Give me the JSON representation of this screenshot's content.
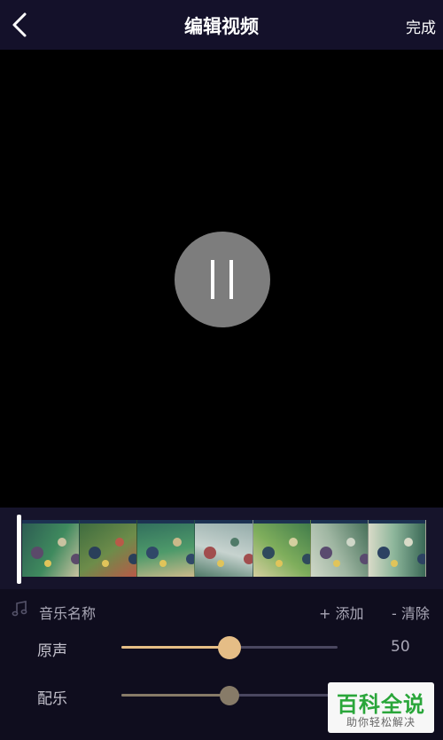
{
  "header": {
    "title": "编辑视频",
    "done_label": "完成",
    "back_icon": "chevron-left-icon"
  },
  "player": {
    "state": "playing",
    "control_icon": "pause-icon"
  },
  "timeline": {
    "frame_count": 7,
    "playhead_icon": "playhead-icon"
  },
  "music": {
    "icon": "music-note-icon",
    "name_label": "音乐名称",
    "add_label": "+ 添加",
    "clear_label": "- 清除"
  },
  "original_audio": {
    "label": "原声",
    "value": 50,
    "value_text": "50",
    "fill_color": "#e5bd86"
  },
  "music_audio": {
    "label": "配乐",
    "value": 50,
    "fill_color": "#877b68"
  },
  "watermark": {
    "title": "百科全说",
    "subtitle": "助你轻松解决",
    "color": "#2aa63a"
  }
}
